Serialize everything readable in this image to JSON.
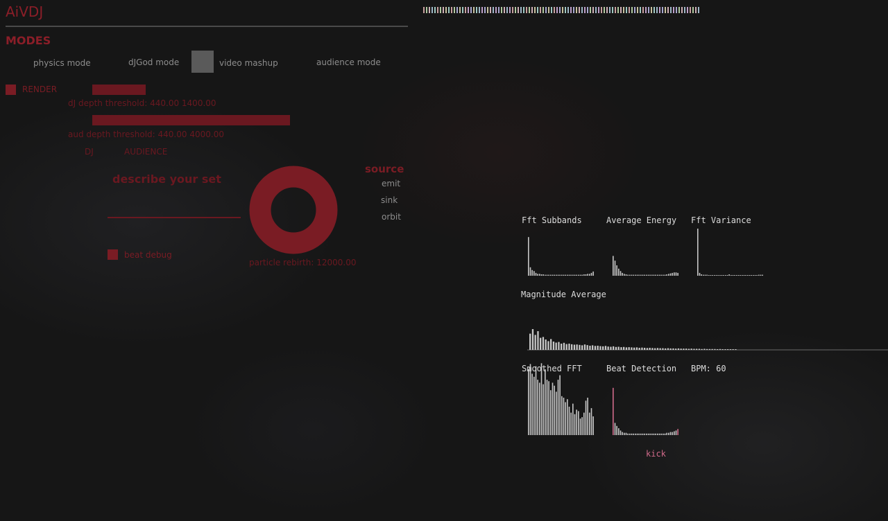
{
  "app_title": "AiVDJ",
  "modes_header": "MODES",
  "modes": [
    "physics mode",
    "dJGod mode",
    "video mashup",
    "audience mode"
  ],
  "render": {
    "label": "RENDER"
  },
  "dj_depth": {
    "label": "dJ depth threshold:",
    "value": "440.00 1400.00"
  },
  "aud_depth": {
    "label": "aud depth threshold:",
    "value": "440.00 4000.00"
  },
  "target_tabs": [
    "DJ",
    "AUDIENCE"
  ],
  "describe_set": {
    "label": "describe your set",
    "value": ""
  },
  "beat_debug": {
    "label": "beat debug"
  },
  "particle_rebirth": {
    "label": "particle rebirth:",
    "value": "12000.00"
  },
  "source": {
    "header": "source",
    "options": [
      "emit",
      "sink",
      "orbit"
    ]
  },
  "graphs": {
    "fft_subbands": "Fft Subbands",
    "average_energy": "Average Energy",
    "fft_variance": "Fft Variance",
    "magnitude_average": "Magnitude Average",
    "smoothed_fft": "Smoothed FFT",
    "beat_detection": "Beat Detection",
    "bpm_label": "BPM: 60"
  },
  "kick_label": "kick",
  "colors": {
    "accent": "#7a1c24",
    "graph": "#c8c8c8",
    "beat": "#d06a8a"
  },
  "viz": {
    "fft_subbands": [
      0.82,
      0.18,
      0.12,
      0.1,
      0.06,
      0.04,
      0.04,
      0.03,
      0.03,
      0.02,
      0.02,
      0.02,
      0.02,
      0.02,
      0.02,
      0.02,
      0.02,
      0.02,
      0.02,
      0.02,
      0.02,
      0.02,
      0.02,
      0.02,
      0.02,
      0.02,
      0.02,
      0.02,
      0.02,
      0.02,
      0.03,
      0.03,
      0.04,
      0.04,
      0.06,
      0.09
    ],
    "average_energy": [
      0.42,
      0.32,
      0.22,
      0.15,
      0.1,
      0.06,
      0.04,
      0.03,
      0.02,
      0.02,
      0.02,
      0.02,
      0.02,
      0.02,
      0.02,
      0.02,
      0.02,
      0.02,
      0.02,
      0.02,
      0.02,
      0.02,
      0.02,
      0.02,
      0.02,
      0.02,
      0.02,
      0.02,
      0.02,
      0.03,
      0.04,
      0.05,
      0.06,
      0.07,
      0.07,
      0.06
    ],
    "fft_variance": [
      1.0,
      0.06,
      0.03,
      0.02,
      0.02,
      0.02,
      0.01,
      0.01,
      0.01,
      0.01,
      0.01,
      0.01,
      0.01,
      0.01,
      0.01,
      0.01,
      0.01,
      0.03,
      0.01,
      0.01,
      0.01,
      0.01,
      0.01,
      0.01,
      0.01,
      0.01,
      0.01,
      0.01,
      0.01,
      0.01,
      0.01,
      0.01,
      0.01,
      0.02,
      0.02,
      0.02
    ],
    "magnitude_average": [
      0.78,
      1.0,
      0.72,
      0.9,
      0.58,
      0.62,
      0.5,
      0.42,
      0.52,
      0.4,
      0.35,
      0.38,
      0.3,
      0.34,
      0.28,
      0.3,
      0.27,
      0.25,
      0.26,
      0.24,
      0.22,
      0.26,
      0.23,
      0.2,
      0.22,
      0.19,
      0.2,
      0.18,
      0.17,
      0.19,
      0.16,
      0.15,
      0.17,
      0.14,
      0.15,
      0.13,
      0.14,
      0.12,
      0.13,
      0.12,
      0.11,
      0.12,
      0.1,
      0.11,
      0.1,
      0.09,
      0.1,
      0.09,
      0.08,
      0.09,
      0.08,
      0.08,
      0.07,
      0.08,
      0.07,
      0.07,
      0.06,
      0.07,
      0.06,
      0.06,
      0.06,
      0.05,
      0.06,
      0.05,
      0.05,
      0.05,
      0.04,
      0.05,
      0.04,
      0.04,
      0.04,
      0.04,
      0.03,
      0.04,
      0.03,
      0.03,
      0.03,
      0.03,
      0.03,
      0.03
    ],
    "smoothed_fft": [
      0.88,
      0.95,
      0.82,
      0.78,
      0.92,
      0.74,
      0.7,
      0.96,
      0.68,
      0.88,
      0.74,
      0.72,
      0.6,
      0.7,
      0.66,
      0.58,
      0.74,
      0.8,
      0.52,
      0.5,
      0.44,
      0.48,
      0.38,
      0.3,
      0.42,
      0.28,
      0.34,
      0.32,
      0.22,
      0.24,
      0.3,
      0.46,
      0.5,
      0.3,
      0.36,
      0.25
    ],
    "beat_detection": [
      0.62,
      0.16,
      0.12,
      0.09,
      0.06,
      0.04,
      0.03,
      0.03,
      0.02,
      0.02,
      0.02,
      0.02,
      0.02,
      0.02,
      0.02,
      0.02,
      0.02,
      0.02,
      0.02,
      0.02,
      0.02,
      0.02,
      0.02,
      0.02,
      0.02,
      0.02,
      0.02,
      0.02,
      0.02,
      0.03,
      0.03,
      0.04,
      0.04,
      0.05,
      0.06,
      0.08
    ],
    "particle_ring_fill": 1.0
  }
}
